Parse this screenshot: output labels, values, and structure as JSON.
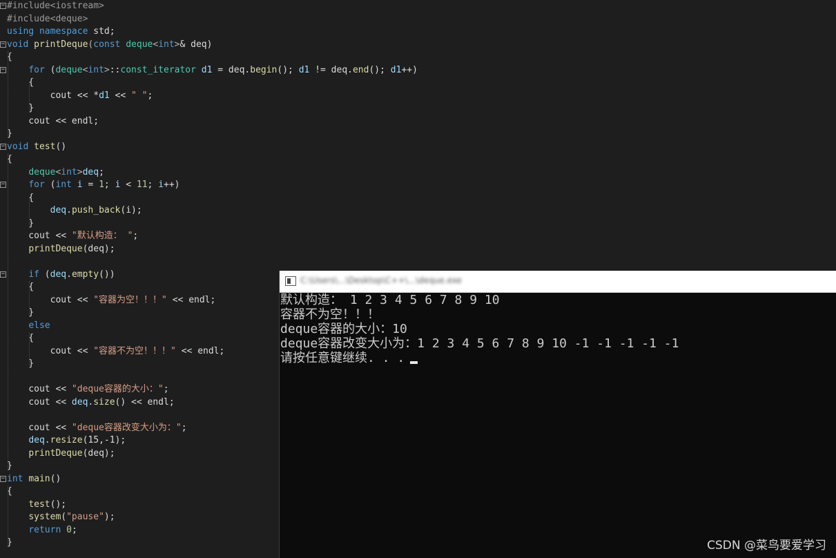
{
  "editor": {
    "lines": [
      [
        [
          "pp",
          "#include<iostream>"
        ]
      ],
      [
        [
          "pp",
          "#include<deque>"
        ]
      ],
      [
        [
          "kw",
          "using"
        ],
        [
          "pl",
          " "
        ],
        [
          "kw",
          "namespace"
        ],
        [
          "pl",
          " std;"
        ]
      ],
      [
        [
          "kw",
          "void"
        ],
        [
          "pl",
          " "
        ],
        [
          "fn",
          "printDeque"
        ],
        [
          "op",
          "("
        ],
        [
          "kw",
          "const"
        ],
        [
          "pl",
          " "
        ],
        [
          "ty",
          "deque"
        ],
        [
          "op",
          "<"
        ],
        [
          "kw",
          "int"
        ],
        [
          "op",
          ">"
        ],
        [
          "pl",
          "& deq)"
        ]
      ],
      [
        [
          "pl",
          "{"
        ]
      ],
      [
        [
          "pl",
          "    "
        ],
        [
          "kw",
          "for"
        ],
        [
          "pl",
          " ("
        ],
        [
          "ty",
          "deque"
        ],
        [
          "op",
          "<"
        ],
        [
          "kw",
          "int"
        ],
        [
          "op",
          ">"
        ],
        [
          "pl",
          "::"
        ],
        [
          "ty",
          "const_iterator"
        ],
        [
          "pl",
          " "
        ],
        [
          "var",
          "d1"
        ],
        [
          "pl",
          " = deq."
        ],
        [
          "fn",
          "begin"
        ],
        [
          "pl",
          "(); "
        ],
        [
          "var",
          "d1"
        ],
        [
          "pl",
          " != deq."
        ],
        [
          "fn",
          "end"
        ],
        [
          "pl",
          "(); "
        ],
        [
          "var",
          "d1"
        ],
        [
          "pl",
          "++)"
        ]
      ],
      [
        [
          "pl",
          "    {"
        ]
      ],
      [
        [
          "pl",
          "        cout << *"
        ],
        [
          "var",
          "d1"
        ],
        [
          "pl",
          " << "
        ],
        [
          "str",
          "\" \""
        ],
        [
          "pl",
          ";"
        ]
      ],
      [
        [
          "pl",
          "    }"
        ]
      ],
      [
        [
          "pl",
          "    cout << endl;"
        ]
      ],
      [
        [
          "pl",
          "}"
        ]
      ],
      [
        [
          "kw",
          "void"
        ],
        [
          "pl",
          " "
        ],
        [
          "fn",
          "test"
        ],
        [
          "pl",
          "()"
        ]
      ],
      [
        [
          "pl",
          "{"
        ]
      ],
      [
        [
          "pl",
          "    "
        ],
        [
          "ty",
          "deque"
        ],
        [
          "op",
          "<"
        ],
        [
          "kw",
          "int"
        ],
        [
          "op",
          ">"
        ],
        [
          "var",
          "deq"
        ],
        [
          "pl",
          ";"
        ]
      ],
      [
        [
          "pl",
          "    "
        ],
        [
          "kw",
          "for"
        ],
        [
          "pl",
          " ("
        ],
        [
          "kw",
          "int"
        ],
        [
          "pl",
          " "
        ],
        [
          "var",
          "i"
        ],
        [
          "pl",
          " = "
        ],
        [
          "num",
          "1"
        ],
        [
          "pl",
          "; "
        ],
        [
          "var",
          "i"
        ],
        [
          "pl",
          " < "
        ],
        [
          "num",
          "11"
        ],
        [
          "pl",
          "; "
        ],
        [
          "var",
          "i"
        ],
        [
          "pl",
          "++)"
        ]
      ],
      [
        [
          "pl",
          "    {"
        ]
      ],
      [
        [
          "pl",
          "        "
        ],
        [
          "var",
          "deq"
        ],
        [
          "pl",
          "."
        ],
        [
          "fn",
          "push_back"
        ],
        [
          "pl",
          "(i);"
        ]
      ],
      [
        [
          "pl",
          "    }"
        ]
      ],
      [
        [
          "pl",
          "    cout << "
        ],
        [
          "str",
          "\"默认构造： \""
        ],
        [
          "pl",
          ";"
        ]
      ],
      [
        [
          "pl",
          "    "
        ],
        [
          "fn",
          "printDeque"
        ],
        [
          "pl",
          "(deq);"
        ]
      ],
      [
        [
          "pl",
          ""
        ]
      ],
      [
        [
          "pl",
          "    "
        ],
        [
          "kw",
          "if"
        ],
        [
          "pl",
          " ("
        ],
        [
          "var",
          "deq"
        ],
        [
          "pl",
          "."
        ],
        [
          "fn",
          "empty"
        ],
        [
          "pl",
          "())"
        ]
      ],
      [
        [
          "pl",
          "    {"
        ]
      ],
      [
        [
          "pl",
          "        cout << "
        ],
        [
          "str",
          "\"容器为空！！！\""
        ],
        [
          "pl",
          " << endl;"
        ]
      ],
      [
        [
          "pl",
          "    }"
        ]
      ],
      [
        [
          "pl",
          "    "
        ],
        [
          "kw",
          "else"
        ]
      ],
      [
        [
          "pl",
          "    {"
        ]
      ],
      [
        [
          "pl",
          "        cout << "
        ],
        [
          "str",
          "\"容器不为空！！！\""
        ],
        [
          "pl",
          " << endl;"
        ]
      ],
      [
        [
          "pl",
          "    }"
        ]
      ],
      [
        [
          "pl",
          ""
        ]
      ],
      [
        [
          "pl",
          "    cout << "
        ],
        [
          "str",
          "\"deque容器的大小：\""
        ],
        [
          "pl",
          ";"
        ]
      ],
      [
        [
          "pl",
          "    cout << "
        ],
        [
          "var",
          "deq"
        ],
        [
          "pl",
          "."
        ],
        [
          "fn",
          "size"
        ],
        [
          "pl",
          "() << endl;"
        ]
      ],
      [
        [
          "pl",
          ""
        ]
      ],
      [
        [
          "pl",
          "    cout << "
        ],
        [
          "str",
          "\"deque容器改变大小为：\""
        ],
        [
          "pl",
          ";"
        ]
      ],
      [
        [
          "pl",
          "    "
        ],
        [
          "var",
          "deq"
        ],
        [
          "pl",
          "."
        ],
        [
          "fn",
          "resize"
        ],
        [
          "pl",
          "(15,-1);"
        ]
      ],
      [
        [
          "pl",
          "    "
        ],
        [
          "fn",
          "printDeque"
        ],
        [
          "pl",
          "(deq);"
        ]
      ],
      [
        [
          "pl",
          "}"
        ]
      ],
      [
        [
          "kw",
          "int"
        ],
        [
          "pl",
          " "
        ],
        [
          "fn",
          "main"
        ],
        [
          "pl",
          "()"
        ]
      ],
      [
        [
          "pl",
          "{"
        ]
      ],
      [
        [
          "pl",
          "    "
        ],
        [
          "fn",
          "test"
        ],
        [
          "pl",
          "();"
        ]
      ],
      [
        [
          "pl",
          "    "
        ],
        [
          "fn",
          "system"
        ],
        [
          "pl",
          "("
        ],
        [
          "str",
          "\"pause\""
        ],
        [
          "pl",
          ");"
        ]
      ],
      [
        [
          "pl",
          "    "
        ],
        [
          "kw",
          "return"
        ],
        [
          "pl",
          " "
        ],
        [
          "num",
          "0"
        ],
        [
          "pl",
          ";"
        ]
      ],
      [
        [
          "pl",
          "}"
        ]
      ]
    ],
    "fold_markers": [
      "⊟",
      "",
      "",
      "⊟",
      "",
      "⊟",
      "",
      "",
      "",
      "",
      "",
      "⊟",
      "",
      "",
      "⊟",
      "",
      "",
      "",
      "",
      "",
      "",
      "⊟",
      "",
      "",
      "",
      "",
      "",
      "",
      "",
      "",
      "",
      "",
      "",
      "",
      "",
      "",
      "",
      "⊟",
      "",
      "",
      "",
      ""
    ]
  },
  "console": {
    "icon": "console-window-icon",
    "title": "C:\\Users\\...\\Desktop\\C++\\...\\deque.exe",
    "lines": [
      "默认构造： 1 2 3 4 5 6 7 8 9 10",
      "容器不为空！！！",
      "deque容器的大小：10",
      "deque容器改变大小为：1 2 3 4 5 6 7 8 9 10 -1 -1 -1 -1 -1",
      "请按任意键继续. . ."
    ]
  },
  "watermark": "CSDN @菜鸟要爱学习",
  "colors": {
    "editor_bg": "#1e1e1e",
    "keyword": "#569cd6",
    "type": "#4ec9b0",
    "string": "#d69d85",
    "console_bg": "#0c0c0c",
    "console_text": "#cccccc"
  }
}
